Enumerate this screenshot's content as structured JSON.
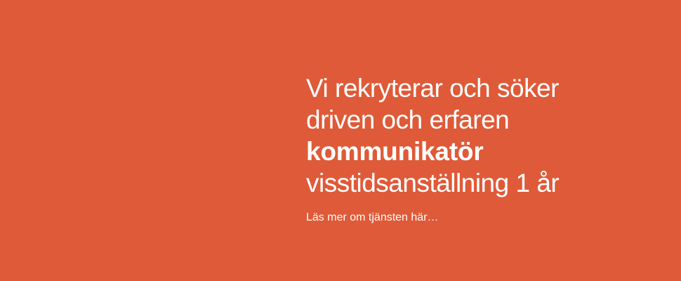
{
  "banner": {
    "background_color": "#df5a38",
    "text_color": "#ffffff",
    "headline": {
      "line1": "Vi rekryterar och söker",
      "line2": "driven och erfaren",
      "line3": "kommunikatör",
      "line4": "visstidsanställning 1 år"
    },
    "cta_text": "Läs mer om tjänsten här…"
  }
}
